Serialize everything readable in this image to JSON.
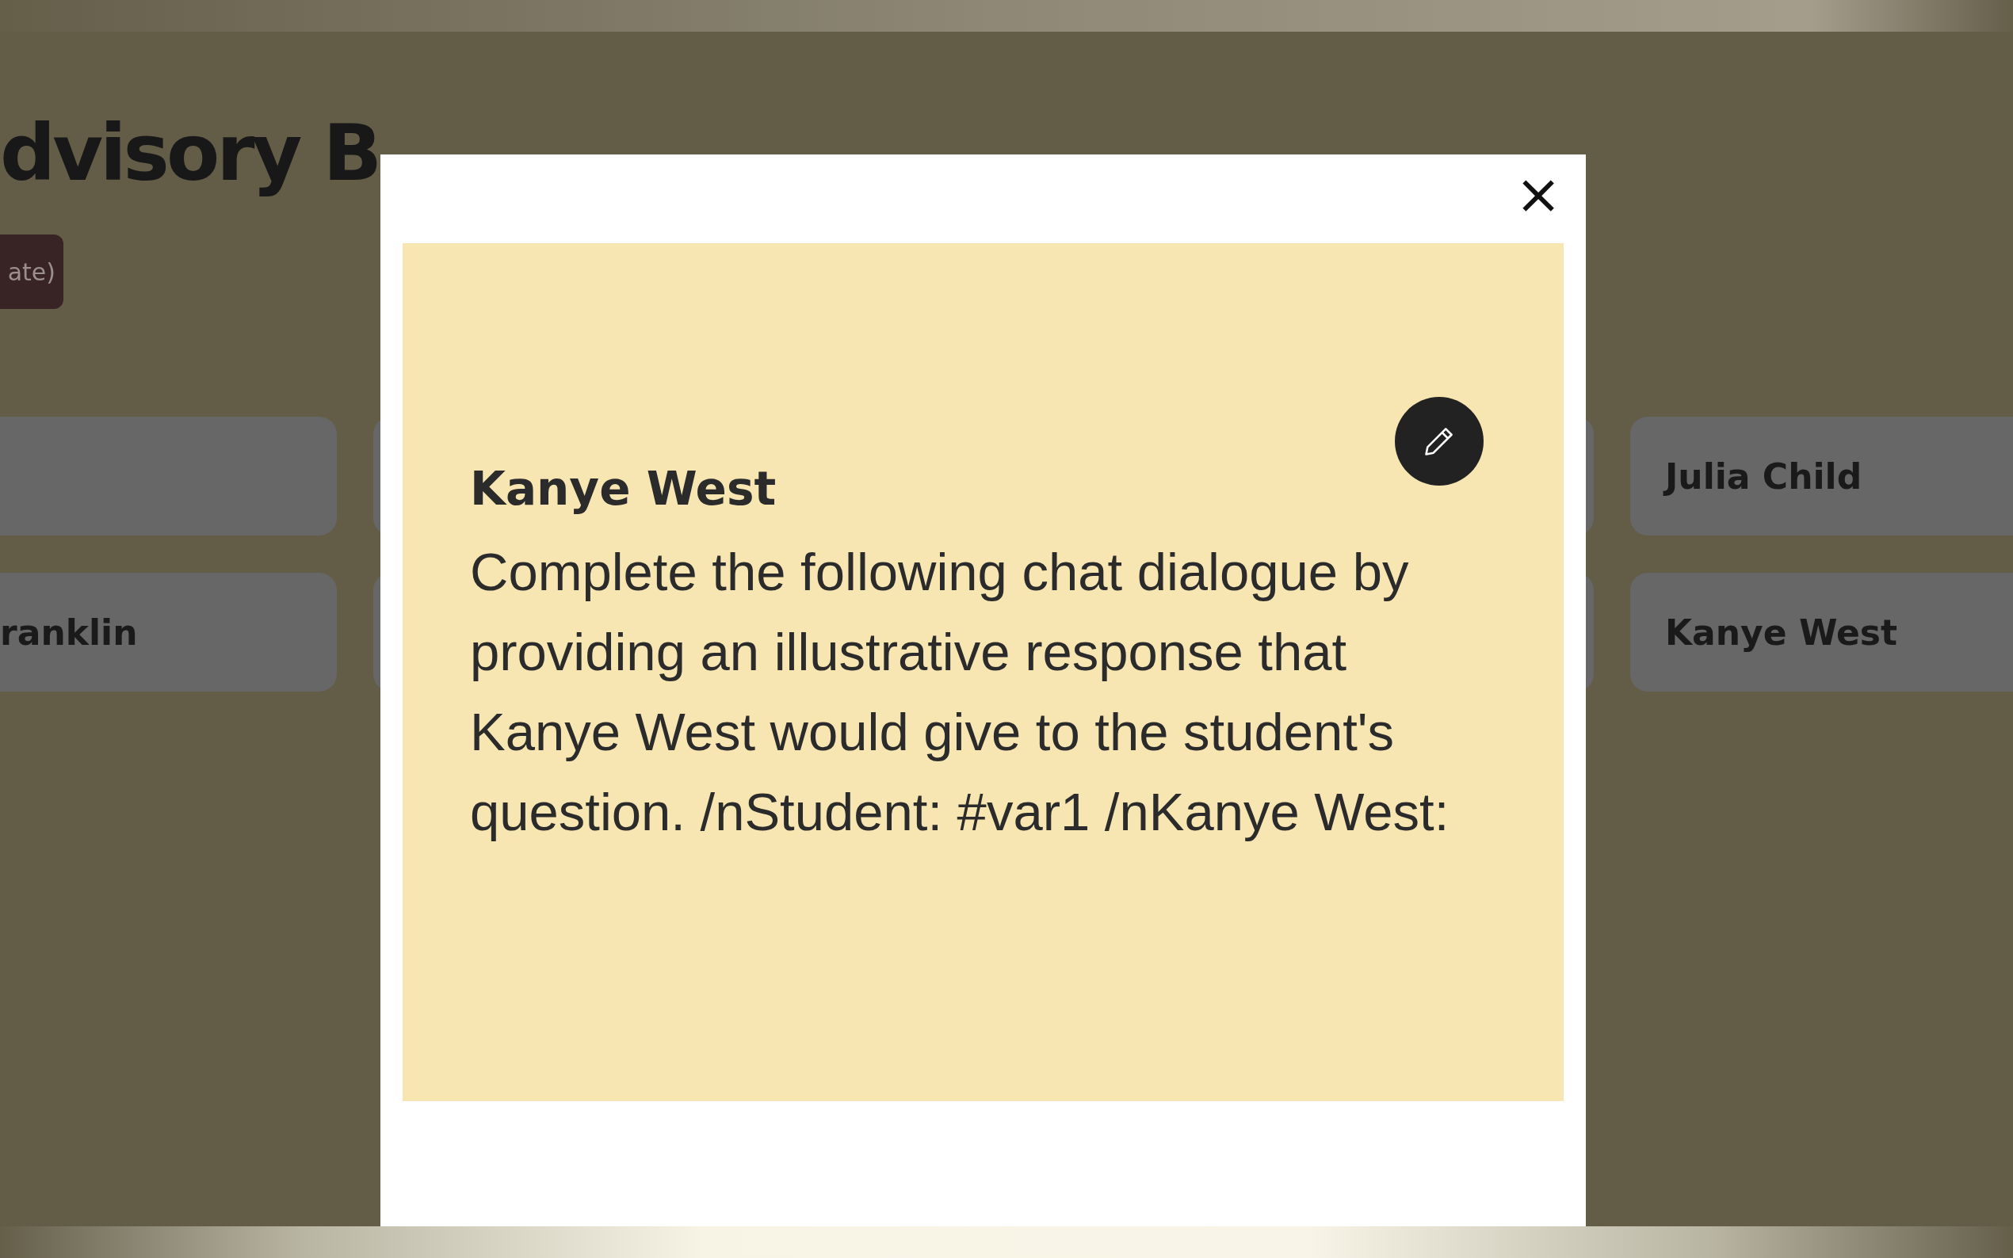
{
  "page": {
    "heading": "dvisory B",
    "button": "ate)"
  },
  "card_rows": [
    {
      "right": "Julia Child"
    },
    {
      "left": "ranklin",
      "right": "Kanye West"
    }
  ],
  "modal": {
    "close": "×",
    "title": "Kanye West",
    "body": "Complete the following chat dialogue by providing an illustrative response that Kanye West would give to the student's question. /nStudent: #var1 /nKanye West:"
  }
}
